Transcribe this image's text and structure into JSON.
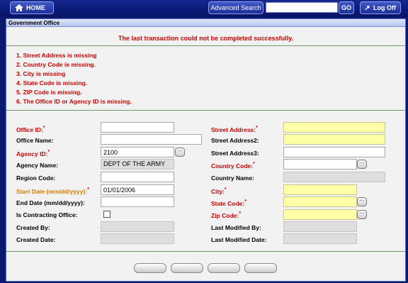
{
  "nav": {
    "home_label": "HOME",
    "advanced_search_label": "Advanced Search",
    "search_value": "",
    "go_label": "GO",
    "logoff_label": "Log Off"
  },
  "panel": {
    "title": "Government Office",
    "status_message": "The last transaction could not be completed successfully."
  },
  "errors": [
    "1. Street Address is missing",
    "2. Country Code is missing.",
    "3. City is missing",
    "4. State Code is missing.",
    "5. ZIP Code is missing.",
    "6. The Office ID or Agency ID is missing."
  ],
  "form": {
    "office_id": {
      "label": "Office ID:",
      "value": ""
    },
    "office_name": {
      "label": "Office Name:",
      "value": ""
    },
    "agency_id": {
      "label": "Agency ID:",
      "value": "2100"
    },
    "agency_name": {
      "label": "Agency Name:",
      "value": "DEPT OF THE ARMY"
    },
    "region_code": {
      "label": "Region Code:",
      "value": ""
    },
    "start_date": {
      "label": "Start Date (mm/dd/yyyy):",
      "value": "01/01/2006"
    },
    "end_date": {
      "label": "End Date (mm/dd/yyyy):",
      "value": ""
    },
    "is_contracting": {
      "label": "Is Contracting Office:"
    },
    "created_by": {
      "label": "Created By:",
      "value": ""
    },
    "created_date": {
      "label": "Created Date:",
      "value": ""
    },
    "street_address": {
      "label": "Street Address:",
      "value": ""
    },
    "street_address2": {
      "label": "Street Address2:",
      "value": ""
    },
    "street_address3": {
      "label": "Street Address3:",
      "value": ""
    },
    "country_code": {
      "label": "Country Code:",
      "value": ""
    },
    "country_name": {
      "label": "Country Name:",
      "value": ""
    },
    "city": {
      "label": "City:",
      "value": ""
    },
    "state_code": {
      "label": "State Code:",
      "value": ""
    },
    "zip_code": {
      "label": "Zip Code:",
      "value": ""
    },
    "last_modified_by": {
      "label": "Last Modified By:",
      "value": ""
    },
    "last_modified_date": {
      "label": "Last Modified Date:",
      "value": ""
    }
  },
  "colors": {
    "error_red": "#d40000",
    "required_orange": "#e07a00",
    "highlight_yellow": "#ffffa8",
    "nav_blue": "#0b1a78"
  }
}
